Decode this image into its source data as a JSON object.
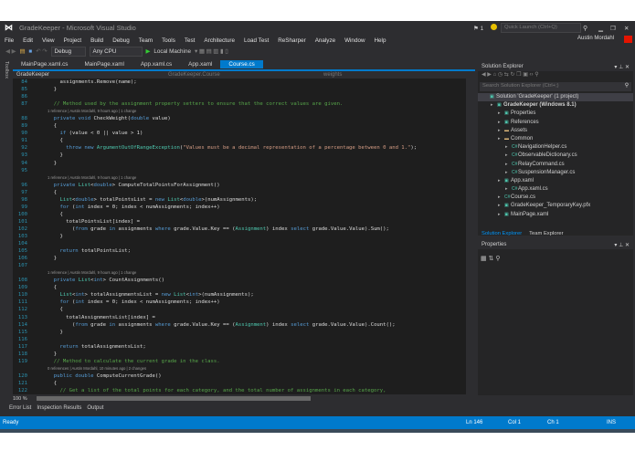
{
  "window": {
    "title": "GradeKeeper - Microsoft Visual Studio",
    "notifications": "1",
    "quick_launch_placeholder": "Quick Launch (Ctrl+Q)",
    "user": "Austin Mordahl"
  },
  "menu": [
    "File",
    "Edit",
    "View",
    "Project",
    "Build",
    "Debug",
    "Team",
    "Tools",
    "Test",
    "Architecture",
    "Load Test",
    "ReSharper",
    "Analyze",
    "Window",
    "Help"
  ],
  "toolbar": {
    "config": "Debug",
    "platform": "Any CPU",
    "run": "Local Machine"
  },
  "tabs": [
    {
      "label": "MainPage.xaml.cs"
    },
    {
      "label": "MainPage.xaml"
    },
    {
      "label": "App.xaml.cs"
    },
    {
      "label": "App.xaml"
    },
    {
      "label": "Course.cs",
      "active": true
    }
  ],
  "toolbox_label": "Toolbox",
  "nav": {
    "project": "GradeKeeper",
    "class": "GradeKeeper.Course",
    "member": "weights"
  },
  "code": [
    {
      "n": "84",
      "seg": [
        [
          "    assignments.Remove(name);",
          "d"
        ]
      ]
    },
    {
      "n": "85",
      "seg": [
        [
          "  }",
          "d"
        ]
      ]
    },
    {
      "n": "86",
      "seg": []
    },
    {
      "n": "87",
      "seg": [
        [
          "  // Method used by the assignment property setters to ensure that the correct values are given.",
          "c"
        ]
      ]
    },
    {
      "lens": "1 reference | Austin Mordahl, 9 hours ago | 1 change"
    },
    {
      "n": "88",
      "seg": [
        [
          "  private void ",
          "k"
        ],
        [
          "CheckWeight(",
          "d"
        ],
        [
          "double",
          "k"
        ],
        [
          " value)",
          "d"
        ]
      ]
    },
    {
      "n": "89",
      "seg": [
        [
          "  {",
          "d"
        ]
      ]
    },
    {
      "n": "90",
      "seg": [
        [
          "    if",
          "k"
        ],
        [
          " (value < 0 || value > 1)",
          "d"
        ]
      ]
    },
    {
      "n": "91",
      "seg": [
        [
          "    {",
          "d"
        ]
      ]
    },
    {
      "n": "92",
      "seg": [
        [
          "      throw new ",
          "k"
        ],
        [
          "ArgumentOutOfRangeException",
          "t"
        ],
        [
          "(",
          "d"
        ],
        [
          "\"Values must be a decimal representation of a percentage between 0 and 1.\"",
          "s"
        ],
        [
          ");",
          "d"
        ]
      ]
    },
    {
      "n": "93",
      "seg": [
        [
          "    }",
          "d"
        ]
      ]
    },
    {
      "n": "94",
      "seg": [
        [
          "  }",
          "d"
        ]
      ]
    },
    {
      "n": "95",
      "seg": []
    },
    {
      "lens": "1 reference | Austin Mordahl, 9 hours ago | 1 change"
    },
    {
      "n": "96",
      "seg": [
        [
          "  private ",
          "k"
        ],
        [
          "List",
          "t"
        ],
        [
          "<",
          "d"
        ],
        [
          "double",
          "k"
        ],
        [
          "> ComputeTotalPointsForAssignment()",
          "d"
        ]
      ]
    },
    {
      "n": "97",
      "seg": [
        [
          "  {",
          "d"
        ]
      ]
    },
    {
      "n": "98",
      "seg": [
        [
          "    List",
          "t"
        ],
        [
          "<",
          "d"
        ],
        [
          "double",
          "k"
        ],
        [
          "> totalPointsList = ",
          "d"
        ],
        [
          "new ",
          "k"
        ],
        [
          "List",
          "t"
        ],
        [
          "<",
          "d"
        ],
        [
          "double",
          "k"
        ],
        [
          ">(numAssignments);",
          "d"
        ]
      ]
    },
    {
      "n": "99",
      "seg": [
        [
          "    for",
          "k"
        ],
        [
          " (",
          "d"
        ],
        [
          "int",
          "k"
        ],
        [
          " index = 0; index < numAssignments; index++)",
          "d"
        ]
      ]
    },
    {
      "n": "100",
      "seg": [
        [
          "    {",
          "d"
        ]
      ]
    },
    {
      "n": "101",
      "seg": [
        [
          "      totalPointsList[index] =",
          "d"
        ]
      ]
    },
    {
      "n": "102",
      "seg": [
        [
          "        (",
          "d"
        ],
        [
          "from",
          "k"
        ],
        [
          " grade ",
          "d"
        ],
        [
          "in",
          "k"
        ],
        [
          " assignments ",
          "d"
        ],
        [
          "where",
          "k"
        ],
        [
          " grade.Value.Key == (",
          "d"
        ],
        [
          "Assignment",
          "t"
        ],
        [
          ") index ",
          "d"
        ],
        [
          "select",
          "k"
        ],
        [
          " grade.Value.Value).Sum();",
          "d"
        ]
      ]
    },
    {
      "n": "103",
      "seg": [
        [
          "    }",
          "d"
        ]
      ]
    },
    {
      "n": "104",
      "seg": []
    },
    {
      "n": "105",
      "seg": [
        [
          "    return",
          "k"
        ],
        [
          " totalPointsList;",
          "d"
        ]
      ]
    },
    {
      "n": "106",
      "seg": [
        [
          "  }",
          "d"
        ]
      ]
    },
    {
      "n": "107",
      "seg": []
    },
    {
      "lens": "1 reference | Austin Mordahl, 9 hours ago | 1 change"
    },
    {
      "n": "108",
      "seg": [
        [
          "  private ",
          "k"
        ],
        [
          "List",
          "t"
        ],
        [
          "<",
          "d"
        ],
        [
          "int",
          "k"
        ],
        [
          "> CountAssignments()",
          "d"
        ]
      ]
    },
    {
      "n": "109",
      "seg": [
        [
          "  {",
          "d"
        ]
      ]
    },
    {
      "n": "110",
      "seg": [
        [
          "    List",
          "t"
        ],
        [
          "<",
          "d"
        ],
        [
          "int",
          "k"
        ],
        [
          "> totalAssignmentsList = ",
          "d"
        ],
        [
          "new ",
          "k"
        ],
        [
          "List",
          "t"
        ],
        [
          "<",
          "d"
        ],
        [
          "int",
          "k"
        ],
        [
          ">(numAssignments);",
          "d"
        ]
      ]
    },
    {
      "n": "111",
      "seg": [
        [
          "    for",
          "k"
        ],
        [
          " (",
          "d"
        ],
        [
          "int",
          "k"
        ],
        [
          " index = 0; index < numAssignments; index++)",
          "d"
        ]
      ]
    },
    {
      "n": "112",
      "seg": [
        [
          "    {",
          "d"
        ]
      ]
    },
    {
      "n": "113",
      "seg": [
        [
          "      totalAssignmentsList[index] =",
          "d"
        ]
      ]
    },
    {
      "n": "114",
      "seg": [
        [
          "        (",
          "d"
        ],
        [
          "from",
          "k"
        ],
        [
          " grade ",
          "d"
        ],
        [
          "in",
          "k"
        ],
        [
          " assignments ",
          "d"
        ],
        [
          "where",
          "k"
        ],
        [
          " grade.Value.Key == (",
          "d"
        ],
        [
          "Assignment",
          "t"
        ],
        [
          ") index ",
          "d"
        ],
        [
          "select",
          "k"
        ],
        [
          " grade.Value.Value).Count();",
          "d"
        ]
      ]
    },
    {
      "n": "115",
      "seg": [
        [
          "    }",
          "d"
        ]
      ]
    },
    {
      "n": "116",
      "seg": []
    },
    {
      "n": "117",
      "seg": [
        [
          "    return",
          "k"
        ],
        [
          " totalAssignmentsList;",
          "d"
        ]
      ]
    },
    {
      "n": "118",
      "seg": [
        [
          "  }",
          "d"
        ]
      ]
    },
    {
      "n": "119",
      "seg": [
        [
          "  // Method to calculate the current grade in the class.",
          "c"
        ]
      ]
    },
    {
      "lens": "0 references | Austin Mordahl, 10 minutes ago | 2 changes"
    },
    {
      "n": "120",
      "seg": [
        [
          "  public double ",
          "k"
        ],
        [
          "ComputeCurrentGrade()",
          "d"
        ]
      ]
    },
    {
      "n": "121",
      "seg": [
        [
          "  {",
          "d"
        ]
      ]
    },
    {
      "n": "122",
      "seg": [
        [
          "    // Get a list of the total points for each category, and the total number of assignments in each category,",
          "c"
        ]
      ]
    }
  ],
  "zoom_level": "100 %",
  "bottom_tabs": [
    "Error List",
    "Inspection Results",
    "Output"
  ],
  "status": {
    "text": "Ready",
    "ln": "Ln 146",
    "col": "Col 1",
    "ch": "Ch 1",
    "mode": "INS"
  },
  "solution_explorer": {
    "title": "Solution Explorer",
    "search_placeholder": "Search Solution Explorer (Ctrl+;)",
    "items": [
      {
        "label": "Solution 'GradeKeeper' (1 project)",
        "depth": 0,
        "icon": "solution-icon"
      },
      {
        "label": "GradeKeeper (Windows 8.1)",
        "depth": 1,
        "icon": "project-icon",
        "bold": true
      },
      {
        "label": "Properties",
        "depth": 2,
        "icon": "wrench-icon"
      },
      {
        "label": "References",
        "depth": 2,
        "icon": "references-icon"
      },
      {
        "label": "Assets",
        "depth": 2,
        "icon": "folder-icon"
      },
      {
        "label": "Common",
        "depth": 2,
        "icon": "folder-icon"
      },
      {
        "label": "NavigationHelper.cs",
        "depth": 3,
        "icon": "csharp-file-icon"
      },
      {
        "label": "ObservableDictionary.cs",
        "depth": 3,
        "icon": "csharp-file-icon"
      },
      {
        "label": "RelayCommand.cs",
        "depth": 3,
        "icon": "csharp-file-icon"
      },
      {
        "label": "SuspensionManager.cs",
        "depth": 3,
        "icon": "csharp-file-icon"
      },
      {
        "label": "App.xaml",
        "depth": 2,
        "icon": "xaml-file-icon"
      },
      {
        "label": "App.xaml.cs",
        "depth": 3,
        "icon": "csharp-file-icon"
      },
      {
        "label": "Course.cs",
        "depth": 2,
        "icon": "csharp-file-icon"
      },
      {
        "label": "GradeKeeper_TemporaryKey.pfx",
        "depth": 2,
        "icon": "key-file-icon"
      },
      {
        "label": "MainPage.xaml",
        "depth": 2,
        "icon": "xaml-file-icon"
      }
    ],
    "tabs": [
      "Solution Explorer",
      "Team Explorer"
    ]
  },
  "properties": {
    "title": "Properties"
  }
}
